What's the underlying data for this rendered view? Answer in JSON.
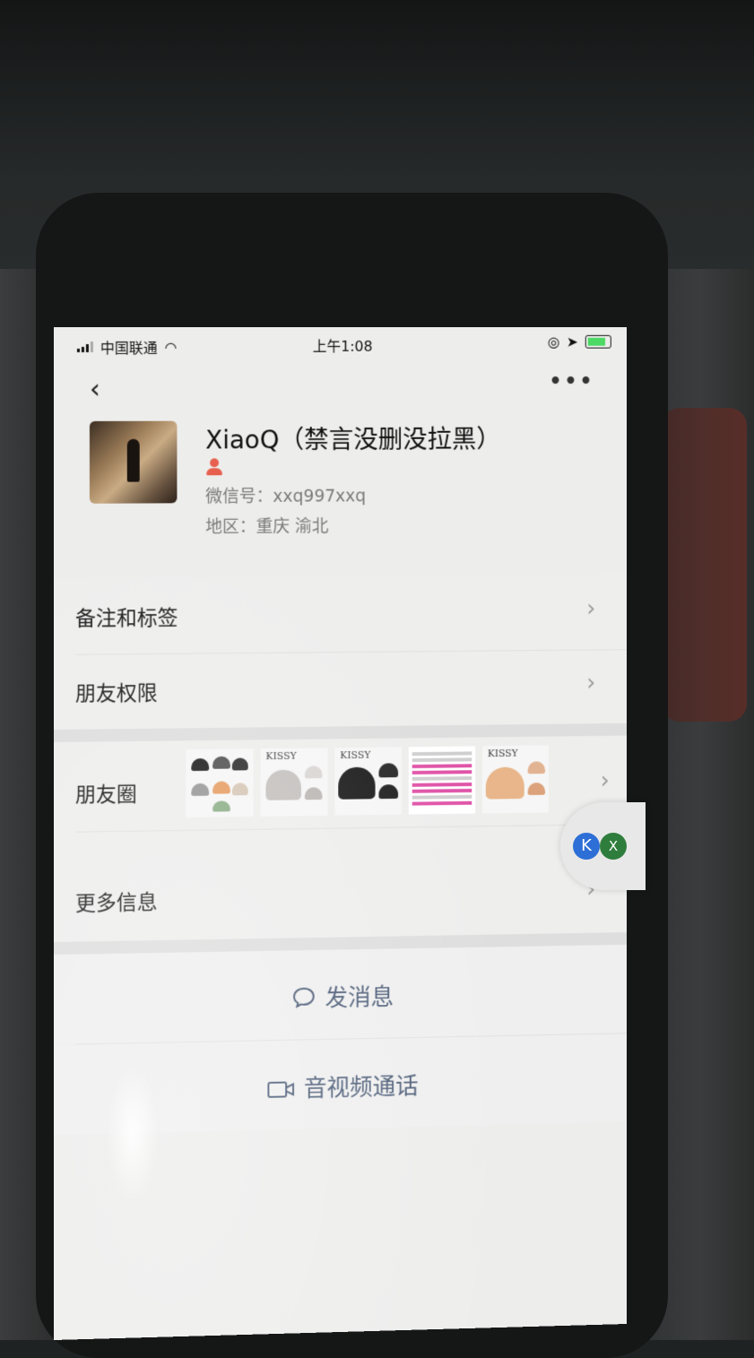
{
  "status_bar": {
    "carrier": "中国联通",
    "time": "上午1:08"
  },
  "nav": {
    "back_icon": "chevron-left-icon",
    "more_icon": "more-dots-icon"
  },
  "profile": {
    "name": "XiaoQ（禁言没删没拉黑）",
    "wechat_id": "微信号：xxq997xxq",
    "region": "地区：重庆 渝北"
  },
  "rows": {
    "remark": "备注和标签",
    "permission": "朋友权限",
    "moments": "朋友圈",
    "more_info": "更多信息"
  },
  "moments_thumbs": [
    {
      "brand": ""
    },
    {
      "brand": "KISSY"
    },
    {
      "brand": "KISSY"
    },
    {
      "brand": ""
    },
    {
      "brand": "KISSY"
    }
  ],
  "actions": {
    "message": "发消息",
    "call": "音视频通话"
  },
  "float": {
    "badge_a": "K",
    "badge_b": "X"
  }
}
